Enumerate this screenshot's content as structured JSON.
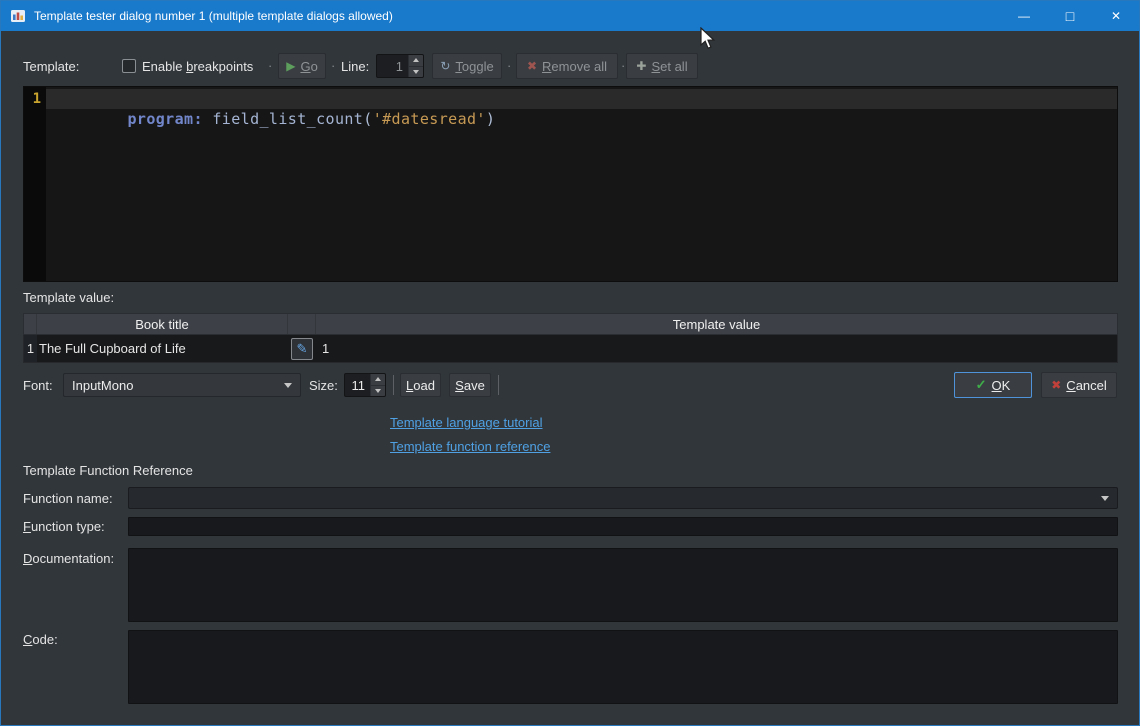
{
  "window": {
    "title": "Template tester dialog number 1 (multiple template dialogs allowed)",
    "minimize_glyph": "—",
    "maximize_glyph": "□",
    "close_glyph": "✕"
  },
  "toolbar": {
    "template_label": "Template:",
    "enable_breakpoints": {
      "label": "Enable breakpoints",
      "accel": 7,
      "checked": false
    },
    "separator": "·",
    "go": {
      "label": "Go",
      "accel": 0,
      "enabled": false
    },
    "go_icon": "▶",
    "line_label": "Line:",
    "line_value": "1",
    "toggle": {
      "label": "Toggle",
      "accel": 0,
      "enabled": false
    },
    "toggle_icon": "↻",
    "remove_all": {
      "label": "Remove all",
      "accel": 0,
      "enabled": false
    },
    "remove_all_icon": "✖",
    "set_all": {
      "label": "Set all",
      "accel": 0,
      "enabled": false
    },
    "set_all_icon": "✚"
  },
  "editor": {
    "line_number": "1",
    "code_text": "program: field_list_count('#datesread')",
    "tokens": [
      {
        "text": "program:",
        "color": "#7287cb",
        "bold": true
      },
      {
        "text": " ",
        "color": "#c8c8c8",
        "bold": false
      },
      {
        "text": "field_list_count",
        "color": "#a4b4d2",
        "bold": false
      },
      {
        "text": "(",
        "color": "#aebdd6",
        "bold": false
      },
      {
        "text": "'#datesread'",
        "color": "#c79a54",
        "bold": false
      },
      {
        "text": ")",
        "color": "#aebdd6",
        "bold": false
      }
    ],
    "colors": {
      "background": "#161616",
      "gutter": "#0a0a0a",
      "current_line": "#2a2a2a",
      "line_number": "#c9a42e"
    }
  },
  "template_value": {
    "label": "Template value:",
    "edit_icon": "✎",
    "table": {
      "headers": [
        "Book title",
        "",
        "Template value"
      ],
      "rows": [
        {
          "num": "1",
          "book_title": "The Full Cupboard of Life",
          "value": "1"
        }
      ]
    }
  },
  "font_row": {
    "font_label": "Font:",
    "font_value": "InputMono",
    "size_label": "Size:",
    "size_value": "11",
    "load": {
      "label": "Load",
      "accel": 0
    },
    "save": {
      "label": "Save",
      "accel": 0
    },
    "ok": {
      "label": "OK",
      "accel": 0
    },
    "ok_icon": "✓",
    "cancel": {
      "label": "Cancel",
      "accel": 0
    },
    "cancel_icon": "✖"
  },
  "links": {
    "tutorial": "Template language tutorial",
    "reference": "Template function reference"
  },
  "function_reference": {
    "title": "Template Function Reference",
    "name_label": {
      "label": "Function name:",
      "accel": -1
    },
    "type_label": {
      "label": "Function type:",
      "accel": 0
    },
    "documentation_label": {
      "label": "Documentation:",
      "accel": 0
    },
    "code_label": {
      "label": "Code:",
      "accel": 0
    },
    "name_value": "",
    "type_value": "",
    "documentation_value": "",
    "code_value": ""
  },
  "colors": {
    "titlebar": "#1979ca",
    "accent": "#4f94da",
    "link": "#4fa1e4",
    "window_bg": "#31363b",
    "button_bg": "#3a3e43"
  }
}
